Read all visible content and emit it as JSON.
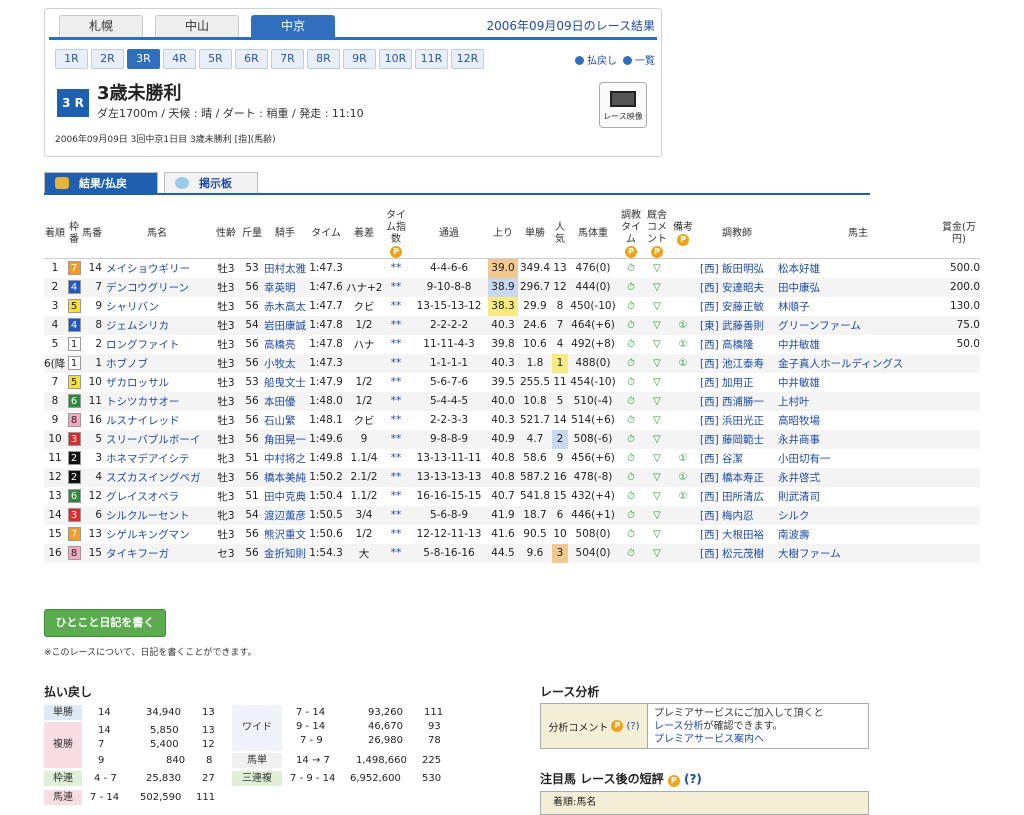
{
  "venues": [
    "札幌",
    "中山",
    "中京"
  ],
  "active_venue": "中京",
  "date_title": "2006年09月09日のレース結果",
  "race_tabs": [
    "1R",
    "2R",
    "3R",
    "4R",
    "5R",
    "6R",
    "7R",
    "8R",
    "9R",
    "10R",
    "11R",
    "12R"
  ],
  "active_race": "3R",
  "links": {
    "back": "払戻し",
    "list": "一覧"
  },
  "race": {
    "badge": "3 R",
    "name": "3歳未勝利",
    "conditions": "ダ左1700m / 天候 : 晴 / ダート : 稍重 / 発走 : 11:10",
    "info": "2006年09月09日 3回中京1日目 3歳未勝利 [指](馬齢)",
    "video_label": "レース映像"
  },
  "subtabs": {
    "results": "結果/払戻",
    "board": "掲示板"
  },
  "table": {
    "headers": {
      "rank": "着順",
      "waku": "枠番",
      "umaban": "馬番",
      "name": "馬名",
      "sex_age": "性齢",
      "kinryo": "斤量",
      "jockey": "騎手",
      "time": "タイム",
      "margin": "着差",
      "time_index": "タイム指数",
      "passing": "通過",
      "last3f": "上り",
      "odds": "単勝",
      "pop": "人気",
      "weight": "馬体重",
      "train_time": "調教タイム",
      "stable_comment": "厩舎コメント",
      "remarks": "備考",
      "trainer": "調教師",
      "owner": "馬主",
      "prize": "賞金(万円)"
    },
    "colors": {
      "1": "#ffffff",
      "2": "#111111",
      "3": "#e0282f",
      "4": "#2159c4",
      "5": "#f7e03a",
      "6": "#2f8a3b",
      "7": "#f59a23",
      "8": "#f4a8c4"
    },
    "rows": [
      {
        "rank": "1",
        "waku": "7",
        "umaban": "14",
        "name": "メイショウギリー",
        "sex_age": "牡3",
        "kinryo": "53",
        "jockey": "田村太雅",
        "time": "1:47.3",
        "margin": "",
        "idx": "**",
        "passing": "4-4-6-6",
        "last3f": "39.0",
        "odds": "349.4",
        "pop": "13",
        "weight": "476(0)",
        "note": "",
        "trainer": "[西] 飯田明弘",
        "owner": "松本好雄",
        "prize": "500.0",
        "hl3f": "o",
        "hlpop": ""
      },
      {
        "rank": "2",
        "waku": "4",
        "umaban": "7",
        "name": "デンコウグリーン",
        "sex_age": "牡3",
        "kinryo": "56",
        "jockey": "幸英明",
        "time": "1:47.6",
        "margin": "ハナ+2",
        "idx": "**",
        "passing": "9-10-8-8",
        "last3f": "38.9",
        "odds": "296.7",
        "pop": "12",
        "weight": "444(0)",
        "note": "",
        "trainer": "[西] 安達昭夫",
        "owner": "田中康弘",
        "prize": "200.0",
        "hl3f": "b",
        "hlpop": ""
      },
      {
        "rank": "3",
        "waku": "5",
        "umaban": "9",
        "name": "シャリバン",
        "sex_age": "牡3",
        "kinryo": "56",
        "jockey": "赤木高太",
        "time": "1:47.7",
        "margin": "クビ",
        "idx": "**",
        "passing": "13-15-13-12",
        "last3f": "38.3",
        "odds": "29.9",
        "pop": "8",
        "weight": "450(-10)",
        "note": "",
        "trainer": "[西] 安藤正敏",
        "owner": "林順子",
        "prize": "130.0",
        "hl3f": "y",
        "hlpop": ""
      },
      {
        "rank": "4",
        "waku": "4",
        "umaban": "8",
        "name": "ジェムシリカ",
        "sex_age": "牡3",
        "kinryo": "54",
        "jockey": "岩田康誠",
        "time": "1:47.8",
        "margin": "1/2",
        "idx": "**",
        "passing": "2-2-2-2",
        "last3f": "40.3",
        "odds": "24.6",
        "pop": "7",
        "weight": "464(+6)",
        "note": "①",
        "trainer": "[東] 武藤善則",
        "owner": "グリーンファーム",
        "prize": "75.0",
        "hl3f": "",
        "hlpop": ""
      },
      {
        "rank": "5",
        "waku": "1",
        "umaban": "2",
        "name": "ロングファイト",
        "sex_age": "牡3",
        "kinryo": "56",
        "jockey": "高橋亮",
        "time": "1:47.8",
        "margin": "ハナ",
        "idx": "**",
        "passing": "11-11-4-3",
        "last3f": "39.8",
        "odds": "10.6",
        "pop": "4",
        "weight": "492(+8)",
        "note": "①",
        "trainer": "[西] 高橋隆",
        "owner": "中井敏雄",
        "prize": "50.0",
        "hl3f": "",
        "hlpop": ""
      },
      {
        "rank": "6(降)",
        "waku": "1",
        "umaban": "1",
        "name": "ホブノブ",
        "sex_age": "牡3",
        "kinryo": "56",
        "jockey": "小牧太",
        "time": "1:47.3",
        "margin": "",
        "idx": "**",
        "passing": "1-1-1-1",
        "last3f": "40.3",
        "odds": "1.8",
        "pop": "1",
        "weight": "488(0)",
        "note": "①",
        "trainer": "[西] 池江泰寿",
        "owner": "金子真人ホールディングス",
        "prize": "",
        "hl3f": "",
        "hlpop": "y"
      },
      {
        "rank": "7",
        "waku": "5",
        "umaban": "10",
        "name": "ザカロッサル",
        "sex_age": "牡3",
        "kinryo": "53",
        "jockey": "船曳文士",
        "time": "1:47.9",
        "margin": "1/2",
        "idx": "**",
        "passing": "5-6-7-6",
        "last3f": "39.5",
        "odds": "255.5",
        "pop": "11",
        "weight": "454(-10)",
        "note": "",
        "trainer": "[西] 加用正",
        "owner": "中井敏雄",
        "prize": "",
        "hl3f": "",
        "hlpop": ""
      },
      {
        "rank": "8",
        "waku": "6",
        "umaban": "11",
        "name": "トシツカサオー",
        "sex_age": "牡3",
        "kinryo": "56",
        "jockey": "本田優",
        "time": "1:48.0",
        "margin": "1/2",
        "idx": "**",
        "passing": "5-4-4-5",
        "last3f": "40.0",
        "odds": "10.8",
        "pop": "5",
        "weight": "510(-4)",
        "note": "",
        "trainer": "[西] 西浦勝一",
        "owner": "上村叶",
        "prize": "",
        "hl3f": "",
        "hlpop": ""
      },
      {
        "rank": "9",
        "waku": "8",
        "umaban": "16",
        "name": "ルスナイレッド",
        "sex_age": "牡3",
        "kinryo": "56",
        "jockey": "石山繁",
        "time": "1:48.1",
        "margin": "クビ",
        "idx": "**",
        "passing": "2-2-3-3",
        "last3f": "40.3",
        "odds": "521.7",
        "pop": "14",
        "weight": "514(+6)",
        "note": "",
        "trainer": "[西] 浜田光正",
        "owner": "高昭牧場",
        "prize": "",
        "hl3f": "",
        "hlpop": ""
      },
      {
        "rank": "10",
        "waku": "3",
        "umaban": "5",
        "name": "スリーバブルボーイ",
        "sex_age": "牡3",
        "kinryo": "56",
        "jockey": "角田晃一",
        "time": "1:49.6",
        "margin": "9",
        "idx": "**",
        "passing": "9-8-8-9",
        "last3f": "40.9",
        "odds": "4.7",
        "pop": "2",
        "weight": "508(-6)",
        "note": "",
        "trainer": "[西] 藤岡範士",
        "owner": "永井商事",
        "prize": "",
        "hl3f": "",
        "hlpop": "b"
      },
      {
        "rank": "11",
        "waku": "2",
        "umaban": "3",
        "name": "ホネマデアイシテ",
        "sex_age": "牝3",
        "kinryo": "51",
        "jockey": "中村将之",
        "time": "1:49.8",
        "margin": "1.1/4",
        "idx": "**",
        "passing": "13-13-11-11",
        "last3f": "40.8",
        "odds": "58.6",
        "pop": "9",
        "weight": "456(+6)",
        "note": "①",
        "trainer": "[西] 谷潔",
        "owner": "小田切有一",
        "prize": "",
        "hl3f": "",
        "hlpop": ""
      },
      {
        "rank": "12",
        "waku": "2",
        "umaban": "4",
        "name": "スズカスイングベガ",
        "sex_age": "牡3",
        "kinryo": "56",
        "jockey": "橋本美純",
        "time": "1:50.2",
        "margin": "2.1/2",
        "idx": "**",
        "passing": "13-13-13-13",
        "last3f": "40.8",
        "odds": "587.2",
        "pop": "16",
        "weight": "478(-8)",
        "note": "①",
        "trainer": "[西] 橋本寿正",
        "owner": "永井啓弍",
        "prize": "",
        "hl3f": "",
        "hlpop": ""
      },
      {
        "rank": "13",
        "waku": "6",
        "umaban": "12",
        "name": "グレイスオペラ",
        "sex_age": "牝3",
        "kinryo": "51",
        "jockey": "田中克典",
        "time": "1:50.4",
        "margin": "1.1/2",
        "idx": "**",
        "passing": "16-16-15-15",
        "last3f": "40.7",
        "odds": "541.8",
        "pop": "15",
        "weight": "432(+4)",
        "note": "①",
        "trainer": "[西] 田所清広",
        "owner": "則武清司",
        "prize": "",
        "hl3f": "",
        "hlpop": ""
      },
      {
        "rank": "14",
        "waku": "3",
        "umaban": "6",
        "name": "シルクルーセント",
        "sex_age": "牝3",
        "kinryo": "54",
        "jockey": "渡辺薫彦",
        "time": "1:50.5",
        "margin": "3/4",
        "idx": "**",
        "passing": "5-6-8-9",
        "last3f": "41.9",
        "odds": "18.7",
        "pop": "6",
        "weight": "446(+1)",
        "note": "",
        "trainer": "[西] 梅内忍",
        "owner": "シルク",
        "prize": "",
        "hl3f": "",
        "hlpop": ""
      },
      {
        "rank": "15",
        "waku": "7",
        "umaban": "13",
        "name": "シゲルキングマン",
        "sex_age": "牡3",
        "kinryo": "56",
        "jockey": "熊沢重文",
        "time": "1:50.6",
        "margin": "1/2",
        "idx": "**",
        "passing": "12-12-11-13",
        "last3f": "41.6",
        "odds": "90.5",
        "pop": "10",
        "weight": "508(0)",
        "note": "",
        "trainer": "[西] 大根田裕",
        "owner": "南波壽",
        "prize": "",
        "hl3f": "",
        "hlpop": ""
      },
      {
        "rank": "16",
        "waku": "8",
        "umaban": "15",
        "name": "タイキフーガ",
        "sex_age": "セ3",
        "kinryo": "56",
        "jockey": "金折知則",
        "time": "1:54.3",
        "margin": "大",
        "idx": "**",
        "passing": "5-8-16-16",
        "last3f": "44.5",
        "odds": "9.6",
        "pop": "3",
        "weight": "504(0)",
        "note": "",
        "trainer": "[西] 松元茂樹",
        "owner": "大樹ファーム",
        "prize": "",
        "hl3f": "",
        "hlpop": "o"
      }
    ]
  },
  "diary": {
    "button": "ひとこと日記を書く",
    "note": "※このレースについて、日記を書くことができます。"
  },
  "payouts": {
    "title": "払い戻し",
    "tansho": {
      "label": "単勝",
      "combo": "14",
      "amount": "34,940",
      "pop": "13"
    },
    "fukusho": {
      "label": "複勝",
      "rows": [
        [
          "14",
          "5,850",
          "13"
        ],
        [
          "7",
          "5,400",
          "12"
        ],
        [
          "9",
          "840",
          "8"
        ]
      ]
    },
    "wakuren": {
      "label": "枠連",
      "combo": "4 - 7",
      "amount": "25,830",
      "pop": "27"
    },
    "umaren": {
      "label": "馬連",
      "combo": "7 - 14",
      "amount": "502,590",
      "pop": "111"
    },
    "wide": {
      "label": "ワイド",
      "rows": [
        [
          "7 - 14",
          "93,260",
          "111"
        ],
        [
          "9 - 14",
          "46,670",
          "93"
        ],
        [
          "7 - 9",
          "26,980",
          "78"
        ]
      ]
    },
    "umatan": {
      "label": "馬単",
      "combo": "14 → 7",
      "amount": "1,498,660",
      "pop": "225"
    },
    "sanrenpuku": {
      "label": "三連複",
      "combo": "7 - 9 - 14",
      "amount": "6,952,600",
      "pop": "530"
    }
  },
  "analysis": {
    "title": "レース分析",
    "label": "分析コメント",
    "help": "(?)",
    "text1": "プレミアサービスにご加入して頂くと",
    "link": "レース分析",
    "text2": "が確認できます。",
    "link2": "プレミアサービス案内へ"
  },
  "attention": {
    "title": "注目馬 レース後の短評",
    "help": "(?)",
    "head": "着順:馬名"
  }
}
